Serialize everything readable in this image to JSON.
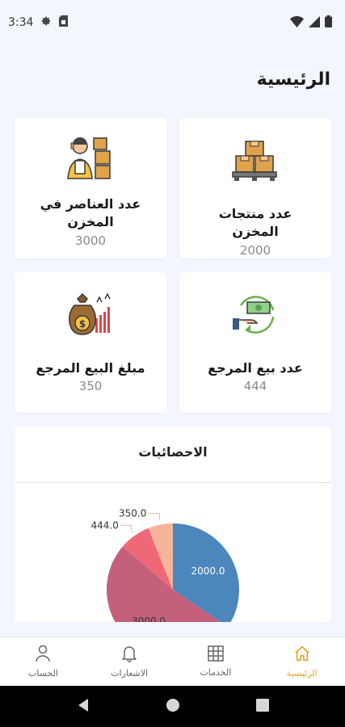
{
  "status_bar": {
    "time": "3:34"
  },
  "page": {
    "title": "الرئيسية"
  },
  "cards": [
    {
      "label": "عدد العناصر في المخزن",
      "value": "3000",
      "icon": "worker-boxes-icon"
    },
    {
      "label": "عدد منتجات المخزن",
      "value": "2000",
      "icon": "boxes-pallet-icon"
    },
    {
      "label": "مبلغ البيع المرجع",
      "value": "350",
      "icon": "money-bag-chart-icon"
    },
    {
      "label": "عدد بيع المرجع",
      "value": "444",
      "icon": "cash-return-icon"
    }
  ],
  "stats": {
    "title": "الاحصائيات"
  },
  "chart_data": {
    "type": "pie",
    "labels": [
      "2000.0",
      "3000.0",
      "444.0",
      "350.0"
    ],
    "values": [
      2000,
      3000,
      444,
      350
    ],
    "colors": [
      "#4b86bd",
      "#c4607a",
      "#ef6877",
      "#f5b49a"
    ]
  },
  "bottom_nav": [
    {
      "label": "الرئيسية",
      "icon": "home-icon",
      "active": true
    },
    {
      "label": "الخدمات",
      "icon": "grid-icon",
      "active": false
    },
    {
      "label": "الاشعارات",
      "icon": "bell-icon",
      "active": false
    },
    {
      "label": "الحساب",
      "icon": "user-icon",
      "active": false
    }
  ],
  "colors": {
    "accent": "#e2a52b",
    "background": "#f3f6fd"
  }
}
